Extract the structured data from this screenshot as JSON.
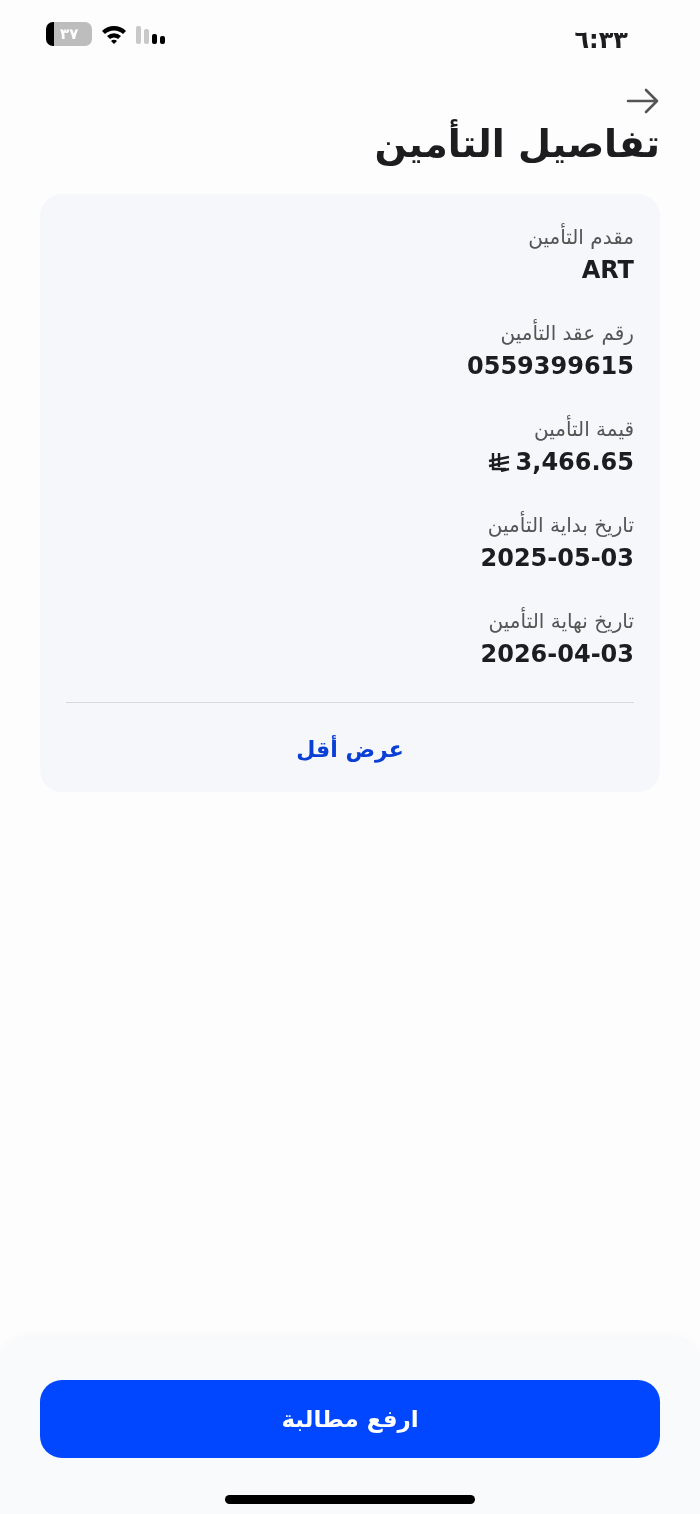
{
  "status_bar": {
    "time": "٦:٣٣",
    "battery": "٣٧"
  },
  "header": {
    "title": "تفاصيل التأمين"
  },
  "details": {
    "fields": [
      {
        "label": "مقدم التأمين",
        "value": "ART",
        "kind": "text"
      },
      {
        "label": "رقم عقد التأمين",
        "value": "0559399615",
        "kind": "text"
      },
      {
        "label": "قيمة التأمين",
        "value": "3,466.65",
        "kind": "money"
      },
      {
        "label": "تاريخ بداية التأمين",
        "value": "2025-05-03",
        "kind": "text"
      },
      {
        "label": "تاريخ نهاية التأمين",
        "value": "2026-04-03",
        "kind": "text"
      }
    ],
    "toggle_link": "عرض أقل"
  },
  "footer": {
    "button": "ارفع مطالبة"
  }
}
